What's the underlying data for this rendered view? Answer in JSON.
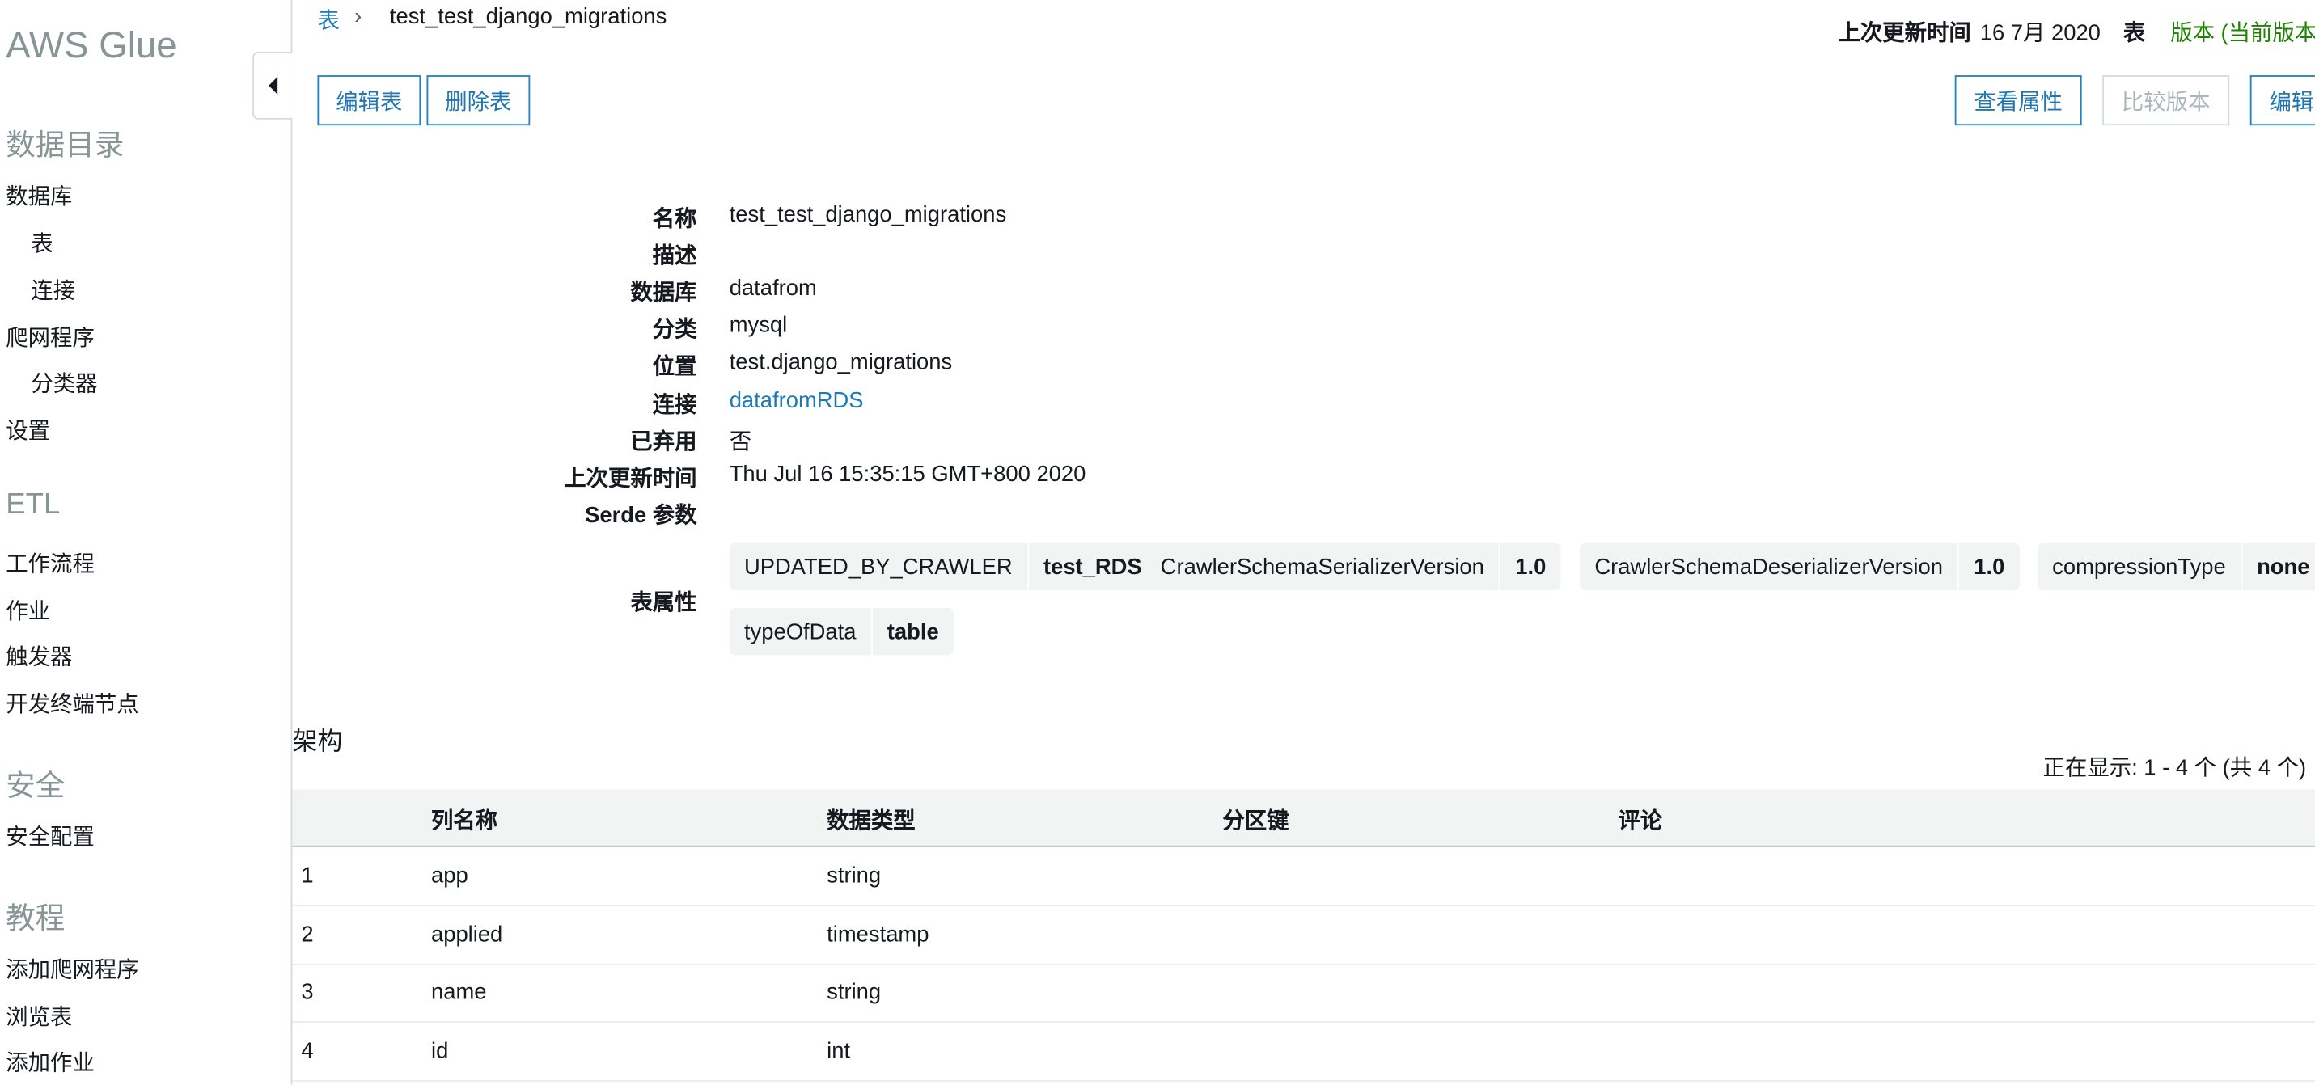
{
  "sidebar": {
    "brand": "AWS Glue",
    "sections": [
      {
        "title": "数据目录",
        "items": [
          {
            "label": "数据库",
            "sub": false
          },
          {
            "label": "表",
            "sub": true
          },
          {
            "label": "连接",
            "sub": true
          },
          {
            "label": "爬网程序",
            "sub": false
          },
          {
            "label": "分类器",
            "sub": true
          },
          {
            "label": "设置",
            "sub": false
          }
        ]
      },
      {
        "title": "ETL",
        "items": [
          {
            "label": "工作流程"
          },
          {
            "label": "作业"
          },
          {
            "label": "触发器"
          },
          {
            "label": "开发终端节点"
          }
        ]
      },
      {
        "title": "安全",
        "items": [
          {
            "label": "安全配置"
          }
        ]
      },
      {
        "title": "教程",
        "items": [
          {
            "label": "添加爬网程序"
          },
          {
            "label": "浏览表"
          },
          {
            "label": "添加作业"
          }
        ]
      }
    ],
    "collapse_icon": "caret-left-icon"
  },
  "breadcrumb": {
    "parent": "表",
    "separator": "›",
    "current": "test_test_django_migrations"
  },
  "header": {
    "last_updated_label": "上次更新时间",
    "last_updated_value": "16 7月 2020",
    "table_label": "表",
    "version_text": "版本 (当前版本"
  },
  "actions": {
    "edit_table": "编辑表",
    "delete_table": "删除表",
    "view_properties": "查看属性",
    "compare_versions": "比较版本",
    "edit_schema": "编辑"
  },
  "details": {
    "name_label": "名称",
    "name": "test_test_django_migrations",
    "description_label": "描述",
    "description": "",
    "database_label": "数据库",
    "database": "datafrom",
    "classification_label": "分类",
    "classification": "mysql",
    "location_label": "位置",
    "location": "test.django_migrations",
    "connection_label": "连接",
    "connection": "datafromRDS",
    "deprecated_label": "已弃用",
    "deprecated": "否",
    "last_updated_label": "上次更新时间",
    "last_updated": "Thu Jul 16 15:35:15 GMT+800 2020",
    "serde_label": "Serde 参数",
    "properties_label": "表属性",
    "properties": [
      {
        "key": "UPDATED_BY_CRAWLER",
        "value": "test_RDS"
      },
      {
        "key": "CrawlerSchemaSerializerVersion",
        "value": "1.0"
      },
      {
        "key": "CrawlerSchemaDeserializerVersion",
        "value": "1.0"
      },
      {
        "key": "compressionType",
        "value": "none"
      },
      {
        "key": "typeOfData",
        "value": "table"
      }
    ]
  },
  "schema": {
    "title": "架构",
    "showing": "正在显示: 1 - 4 个  (共 4 个)",
    "columns": [
      "",
      "列名称",
      "数据类型",
      "分区键",
      "评论"
    ],
    "rows": [
      {
        "num": "1",
        "name": "app",
        "type": "string",
        "partition": "",
        "comment": ""
      },
      {
        "num": "2",
        "name": "applied",
        "type": "timestamp",
        "partition": "",
        "comment": ""
      },
      {
        "num": "3",
        "name": "name",
        "type": "string",
        "partition": "",
        "comment": ""
      },
      {
        "num": "4",
        "name": "id",
        "type": "int",
        "partition": "",
        "comment": ""
      }
    ]
  },
  "colors": {
    "link": "#1b7ab8",
    "version_green": "#1d8102",
    "muted": "#879596"
  }
}
